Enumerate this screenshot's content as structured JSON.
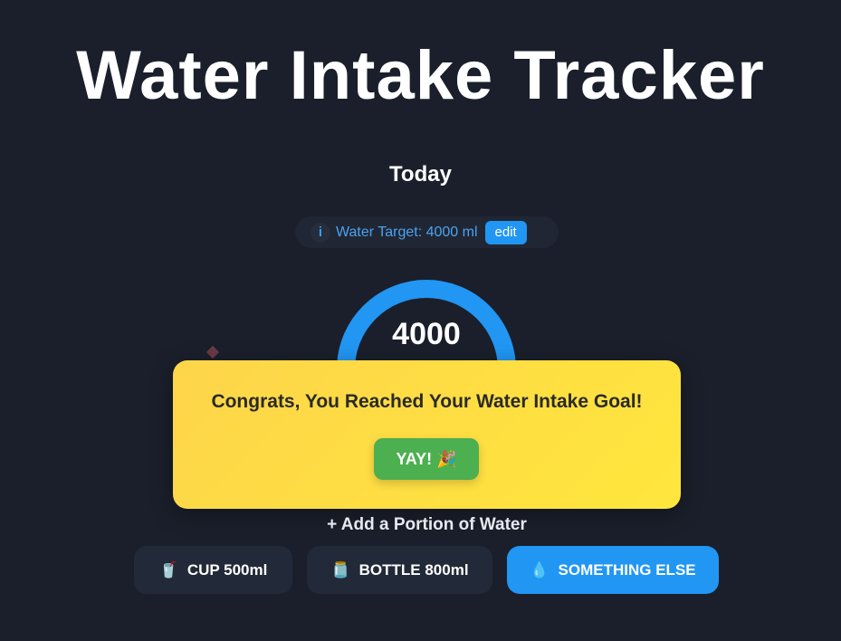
{
  "app": {
    "title": "Water Intake Tracker",
    "day_label": "Today"
  },
  "target": {
    "info_icon": "i",
    "text": "Water Target: 4000 ml",
    "edit_label": "edit"
  },
  "progress": {
    "amount": "4000",
    "fraction": 1.0,
    "ring_color": "#2196f3"
  },
  "modal": {
    "message": "Congrats, You Reached Your Water Intake Goal!",
    "button_label": "YAY! 🎉"
  },
  "portion": {
    "heading": "+ Add a Portion of Water",
    "buttons": [
      {
        "icon": "🥤",
        "icon_name": "cup-icon",
        "label": "CUP 500ml"
      },
      {
        "icon": "🫙",
        "icon_name": "bottle-icon",
        "label": "BOTTLE 800ml"
      },
      {
        "icon": "💧",
        "icon_name": "droplet-icon",
        "label": "SOMETHING ELSE"
      }
    ]
  },
  "colors": {
    "background": "#1a1f2b",
    "accent": "#2196f3",
    "modal": "#fdd54a",
    "success": "#4caf50"
  }
}
